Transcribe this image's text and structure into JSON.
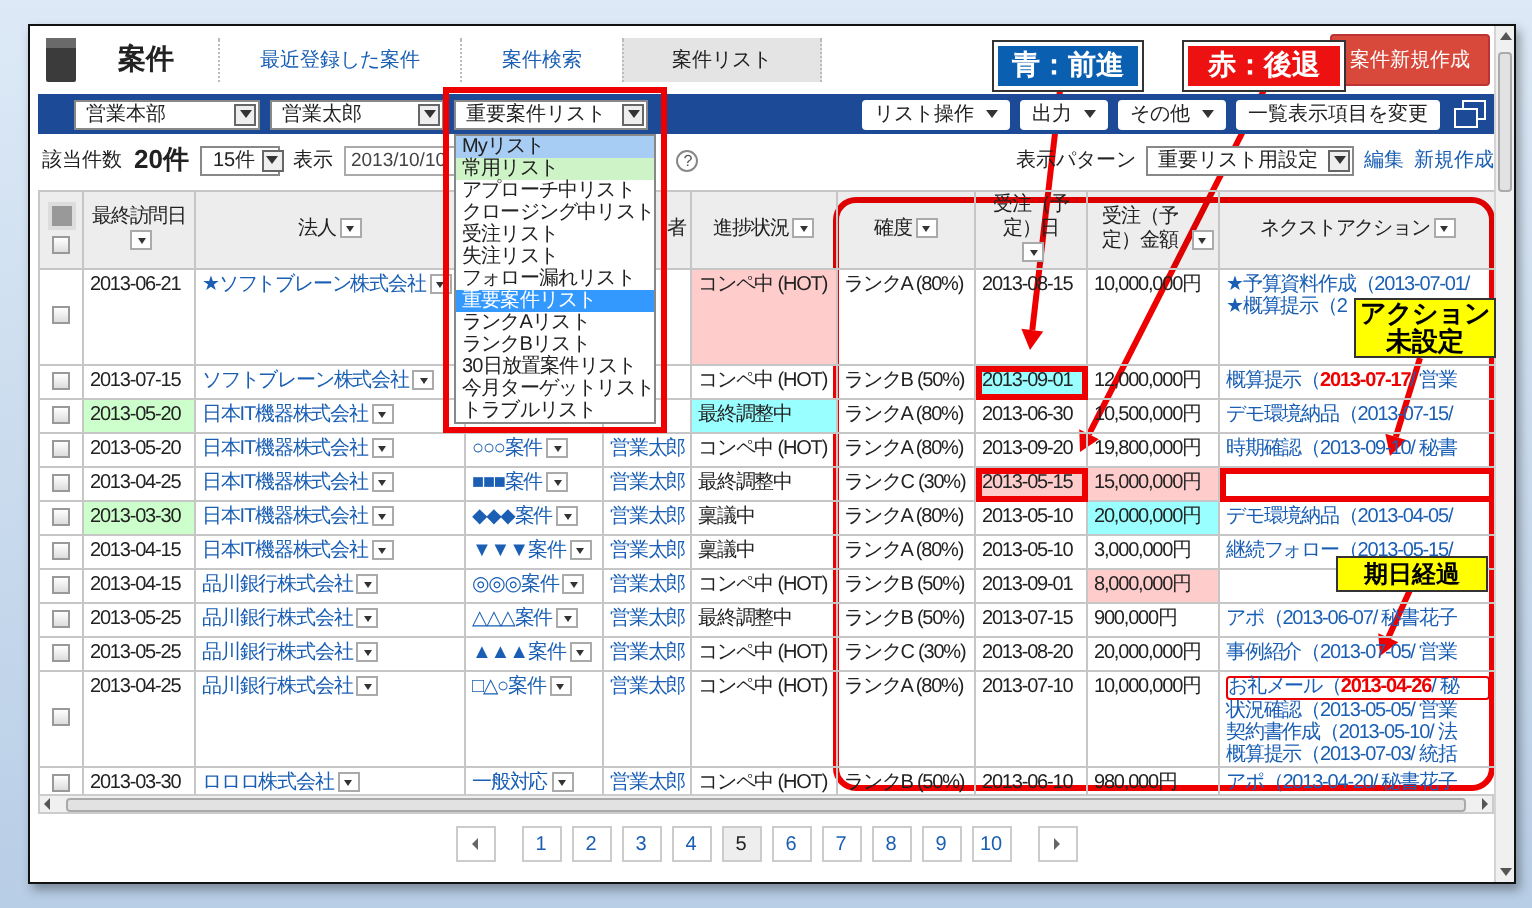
{
  "header": {
    "title": "案件",
    "tabs": [
      {
        "label": "最近登録した案件",
        "selected": false
      },
      {
        "label": "案件検索",
        "selected": false
      },
      {
        "label": "案件リスト",
        "selected": true
      }
    ],
    "new_button": "案件新規作成"
  },
  "toolbar": {
    "filters": [
      "営業本部",
      "営業太郎"
    ],
    "list_select": "重要案件リスト",
    "buttons": [
      "リスト操作",
      "出力",
      "その他"
    ],
    "change_columns_button": "一覧表示項目を変更"
  },
  "summary": {
    "count_label": "該当件数",
    "count": "20件",
    "per_page": "15件",
    "display_label": "表示",
    "date": "2013/10/10",
    "help": "?",
    "pattern_label": "表示パターン",
    "pattern": "重要リスト用設定",
    "links": [
      "編集",
      "新規作成"
    ]
  },
  "list_menu": [
    {
      "label": "Myリスト",
      "kind": "heading",
      "color": "#a8cdf4"
    },
    {
      "label": "常用リスト",
      "kind": "heading",
      "color": "#cdf3c6"
    },
    {
      "label": "アプローチ中リスト",
      "kind": "item",
      "selected": false
    },
    {
      "label": "クロージング中リスト",
      "kind": "item",
      "selected": false
    },
    {
      "label": "受注リスト",
      "kind": "item",
      "selected": false
    },
    {
      "label": "失注リスト",
      "kind": "item",
      "selected": false
    },
    {
      "label": "フォロー漏れリスト",
      "kind": "item",
      "selected": false
    },
    {
      "label": "重要案件リスト",
      "kind": "item",
      "selected": true
    },
    {
      "label": "ランクAリスト",
      "kind": "item",
      "selected": false
    },
    {
      "label": "ランクBリスト",
      "kind": "item",
      "selected": false
    },
    {
      "label": "30日放置案件リスト",
      "kind": "item",
      "selected": false
    },
    {
      "label": "今月ターゲットリスト",
      "kind": "item",
      "selected": false
    },
    {
      "label": "トラブルリスト",
      "kind": "item",
      "selected": false
    }
  ],
  "table": {
    "header_checked": false,
    "columns": {
      "last_visit": "最終訪問日",
      "company": "法人",
      "column_5": "者",
      "status": "進捗状況",
      "certainty": "確度",
      "order_date": "受注（予定）日",
      "amount": "受注（予定）金額",
      "next_action": "ネクストアクション"
    },
    "rows": [
      {
        "checked": false,
        "last_visit": "2013-06-21",
        "company": "★ソフトブレーン株式会社",
        "status": {
          "text": "コンペ中 (HOT)",
          "color": "#ffcccc"
        },
        "rank": "ランクA (80%)",
        "order_date": "2013-08-15",
        "date_boxed": false,
        "amount": "10,000,000円",
        "actions": [
          {
            "text": "★予算資料作成（2013-07-01/",
            "boxed": false
          },
          {
            "text": "★概算提示（2",
            "boxed": false
          }
        ],
        "action_boxed": false
      },
      {
        "checked": false,
        "last_visit": "2013-07-15",
        "company": "ソフトブレーン株式会社",
        "status": "コンペ中 (HOT)",
        "rank": "ランクB (50%)",
        "order_date": {
          "text": "2013-09-01",
          "color": "#99ffff"
        },
        "date_boxed": true,
        "amount": "12,000,000円",
        "actions": [
          {
            "text": "概算提示（**2013-07-17**/ 営業",
            "boxed": false
          }
        ],
        "action_boxed": false
      },
      {
        "checked": false,
        "last_visit": {
          "text": "2013-05-20",
          "color": "#ccffcc"
        },
        "company": "日本IT機器株式会社",
        "status": {
          "text": "最終調整中",
          "color": "#99ffff"
        },
        "rank": "ランクA (80%)",
        "order_date": "2013-06-30",
        "date_boxed": false,
        "amount": "10,500,000円",
        "actions": [
          {
            "text": "デモ環境納品（2013-07-15/",
            "boxed": false
          }
        ],
        "action_boxed": false
      },
      {
        "checked": false,
        "last_visit": "2013-05-20",
        "company": "日本IT機器株式会社",
        "case": "○○○案件",
        "owner": "営業太郎",
        "status": "コンペ中 (HOT)",
        "rank": "ランクA (80%)",
        "order_date": "2013-09-20",
        "date_boxed": false,
        "amount": "19,800,000円",
        "actions": [
          {
            "text": "時期確認（2013-09-10/ 秘書",
            "boxed": false
          }
        ],
        "action_boxed": false
      },
      {
        "checked": false,
        "last_visit": "2013-04-25",
        "company": "日本IT機器株式会社",
        "case": "■■■案件",
        "owner": "営業太郎",
        "status": "最終調整中",
        "rank": "ランクC (30%)",
        "order_date": {
          "text": "2013-05-15",
          "color": "#ffcccc"
        },
        "date_boxed": true,
        "amount": {
          "text": "15,000,000円",
          "color": "#ffcccc"
        },
        "actions": [],
        "action_boxed": true
      },
      {
        "checked": false,
        "last_visit": {
          "text": "2013-03-30",
          "color": "#ccffcc"
        },
        "company": "日本IT機器株式会社",
        "case": "◆◆◆案件",
        "owner": "営業太郎",
        "status": "稟議中",
        "rank": "ランクA (80%)",
        "order_date": "2013-05-10",
        "date_boxed": false,
        "amount": {
          "text": "20,000,000円",
          "color": "#99ffff"
        },
        "actions": [
          {
            "text": "デモ環境納品（2013-04-05/",
            "boxed": false
          }
        ],
        "action_boxed": false
      },
      {
        "checked": false,
        "last_visit": "2013-04-15",
        "company": "日本IT機器株式会社",
        "case": "▼▼▼案件",
        "owner": "営業太郎",
        "status": "稟議中",
        "rank": "ランクA (80%)",
        "order_date": "2013-05-10",
        "date_boxed": false,
        "amount": "3,000,000円",
        "actions": [
          {
            "text": "継続フォロー（2013-05-15/",
            "boxed": false
          }
        ],
        "action_boxed": false
      },
      {
        "checked": false,
        "last_visit": "2013-04-15",
        "company": "品川銀行株式会社",
        "case": "◎◎◎案件",
        "owner": "営業太郎",
        "status": "コンペ中 (HOT)",
        "rank": "ランクB (50%)",
        "order_date": "2013-09-01",
        "date_boxed": false,
        "amount": {
          "text": "8,000,000円",
          "color": "#ffcccc"
        },
        "actions": [],
        "action_boxed": false
      },
      {
        "checked": false,
        "last_visit": "2013-05-25",
        "company": "品川銀行株式会社",
        "case": "△△△案件",
        "owner": "営業太郎",
        "status": "最終調整中",
        "rank": "ランクB (50%)",
        "order_date": "2013-07-15",
        "date_boxed": false,
        "amount": "900,000円",
        "actions": [
          {
            "text": "アポ（2013-06-07/ 秘書花子",
            "boxed": false
          }
        ],
        "action_boxed": false
      },
      {
        "checked": false,
        "last_visit": "2013-05-25",
        "company": "品川銀行株式会社",
        "case": "▲▲▲案件",
        "owner": "営業太郎",
        "status": "コンペ中 (HOT)",
        "rank": "ランクC (30%)",
        "order_date": "2013-08-20",
        "date_boxed": false,
        "amount": "20,000,000円",
        "actions": [
          {
            "text": "事例紹介（2013-07-05/ 営業",
            "boxed": false
          }
        ],
        "action_boxed": false
      },
      {
        "checked": false,
        "last_visit": "2013-04-25",
        "company": "品川銀行株式会社",
        "case": "□△○案件",
        "owner": "営業太郎",
        "status": "コンペ中 (HOT)",
        "rank": "ランクA (80%)",
        "order_date": "2013-07-10",
        "date_boxed": false,
        "amount": "10,000,000円",
        "actions": [
          {
            "text": "お礼メール（**2013-04-26**/ 秘",
            "boxed": true
          },
          {
            "text": "状況確認（2013-05-05/ 営業",
            "boxed": false
          },
          {
            "text": "契約書作成（2013-05-10/ 法",
            "boxed": false
          },
          {
            "text": "概算提示（2013-07-03/ 統括",
            "boxed": false
          }
        ],
        "action_boxed": false
      },
      {
        "checked": false,
        "last_visit": "2013-03-30",
        "company": "ロロロ株式会社",
        "case": "一般対応",
        "owner": "営業太郎",
        "status": "コンペ中 (HOT)",
        "rank": "ランクB (50%)",
        "order_date": "2013-06-10",
        "date_boxed": false,
        "amount": "980,000円",
        "actions": [
          {
            "text": "アポ（2013-04-20/ 秘書花子",
            "boxed": false
          }
        ],
        "action_boxed": false
      }
    ]
  },
  "pagination": [
    {
      "label": "1",
      "selected": false
    },
    {
      "label": "2",
      "selected": false
    },
    {
      "label": "3",
      "selected": false
    },
    {
      "label": "4",
      "selected": false
    },
    {
      "label": "5",
      "selected": true
    },
    {
      "label": "6",
      "selected": false
    },
    {
      "label": "7",
      "selected": false
    },
    {
      "label": "8",
      "selected": false
    },
    {
      "label": "9",
      "selected": false
    },
    {
      "label": "10",
      "selected": false
    }
  ],
  "annotations": [
    {
      "kind": "label",
      "text": "青：前進",
      "color": "#0a5fb0"
    },
    {
      "kind": "label",
      "text": "赤：後退",
      "color": "#ee1111"
    },
    {
      "kind": "note",
      "text": "アクション未設定"
    },
    {
      "kind": "note",
      "text": "期日経過"
    }
  ]
}
